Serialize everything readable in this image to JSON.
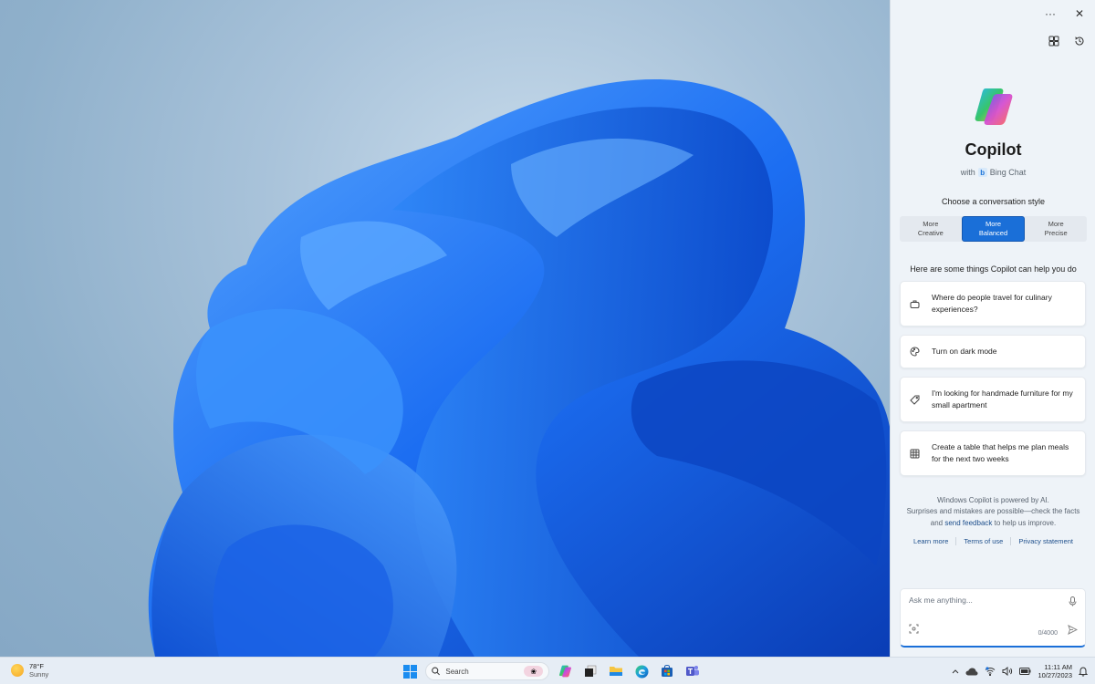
{
  "desktop": {
    "wallpaper": "Windows 11 Bloom",
    "colors": {
      "bg_light": "#c9dcec",
      "bg_dark": "#86a8c5",
      "bloom_light": "#3d8ef5",
      "bloom_mid": "#1d6ff0",
      "bloom_dark": "#0a3fb8"
    }
  },
  "copilot": {
    "top_actions": [
      {
        "name": "more-options",
        "icon": "ellipsis-icon",
        "glyph": "···"
      },
      {
        "name": "close",
        "icon": "close-icon",
        "glyph": "✕"
      }
    ],
    "secondary_actions": [
      {
        "name": "plugins",
        "icon": "plugins-icon"
      },
      {
        "name": "history",
        "icon": "history-icon"
      }
    ],
    "title": "Copilot",
    "subtitle_prefix": "with",
    "subtitle_badge": "b",
    "subtitle_product": "Bing Chat",
    "style_prompt": "Choose a conversation style",
    "styles": [
      {
        "line1": "More",
        "line2": "Creative",
        "active": false
      },
      {
        "line1": "More",
        "line2": "Balanced",
        "active": true
      },
      {
        "line1": "More",
        "line2": "Precise",
        "active": false
      }
    ],
    "help_prompt": "Here are some things Copilot can help you do",
    "suggestions": [
      {
        "icon": "suitcase-icon",
        "text": "Where do people travel for culinary experiences?"
      },
      {
        "icon": "palette-icon",
        "text": "Turn on dark mode"
      },
      {
        "icon": "tag-icon",
        "text": "I'm looking for handmade furniture for my small apartment"
      },
      {
        "icon": "table-icon",
        "text": "Create a table that helps me plan meals for the next two weeks"
      }
    ],
    "disclaimer": {
      "line1": "Windows Copilot is powered by AI.",
      "line2": "Surprises and mistakes are possible—check the facts and ",
      "link": "send feedback",
      "line3": " to help us improve."
    },
    "links": [
      "Learn more",
      "Terms of use",
      "Privacy statement"
    ],
    "composer": {
      "placeholder": "Ask me anything...",
      "value": "",
      "counter": "0/4000"
    },
    "accent": "#1a6fd8"
  },
  "taskbar": {
    "weather": {
      "temp": "78°F",
      "condition": "Sunny"
    },
    "search_placeholder": "Search",
    "apps": [
      {
        "name": "start",
        "icon": "windows-start-icon"
      },
      {
        "name": "copilot",
        "icon": "copilot-icon"
      },
      {
        "name": "task-view",
        "icon": "task-view-icon"
      },
      {
        "name": "file-explorer",
        "icon": "folder-icon"
      },
      {
        "name": "edge",
        "icon": "edge-icon"
      },
      {
        "name": "microsoft-store",
        "icon": "store-icon"
      },
      {
        "name": "teams",
        "icon": "teams-icon"
      }
    ],
    "tray": {
      "time": "11:11 AM",
      "date": "10/27/2023"
    }
  }
}
